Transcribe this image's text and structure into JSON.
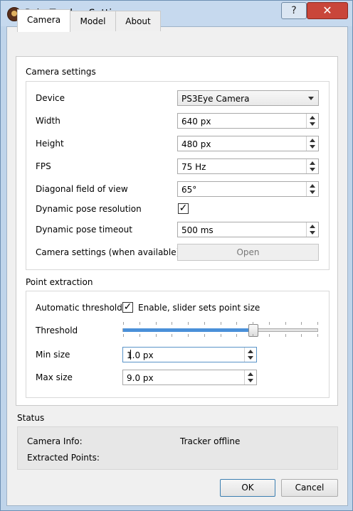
{
  "window": {
    "title": "PointTracker Settings",
    "help_glyph": "?",
    "close_glyph": "✕"
  },
  "tabs": [
    {
      "label": "Camera"
    },
    {
      "label": "Model"
    },
    {
      "label": "About"
    }
  ],
  "camera_settings": {
    "title": "Camera settings",
    "device_label": "Device",
    "device_value": "PS3Eye Camera",
    "width_label": "Width",
    "width_value": "640 px",
    "height_label": "Height",
    "height_value": "480 px",
    "fps_label": "FPS",
    "fps_value": "75 Hz",
    "fov_label": "Diagonal field of view",
    "fov_value": "65°",
    "dyn_res_label": "Dynamic pose resolution",
    "dyn_res_checked": "✓",
    "dyn_timeout_label": "Dynamic pose timeout",
    "dyn_timeout_value": "500 ms",
    "cam_settings_label": "Camera settings (when available)",
    "open_button": "Open"
  },
  "point_extraction": {
    "title": "Point extraction",
    "auto_threshold_label": "Automatic threshold",
    "auto_threshold_checked": "✓",
    "auto_threshold_text": "Enable, slider sets point size",
    "threshold_label": "Threshold",
    "threshold_level": 0.67,
    "min_size_label": "Min size",
    "min_size_value": "1.0 px",
    "max_size_label": "Max size",
    "max_size_value": "9.0 px"
  },
  "status": {
    "title": "Status",
    "camera_info_label": "Camera Info:",
    "camera_info_value": "Tracker offline",
    "extracted_points_label": "Extracted Points:"
  },
  "buttons": {
    "ok": "OK",
    "cancel": "Cancel"
  }
}
